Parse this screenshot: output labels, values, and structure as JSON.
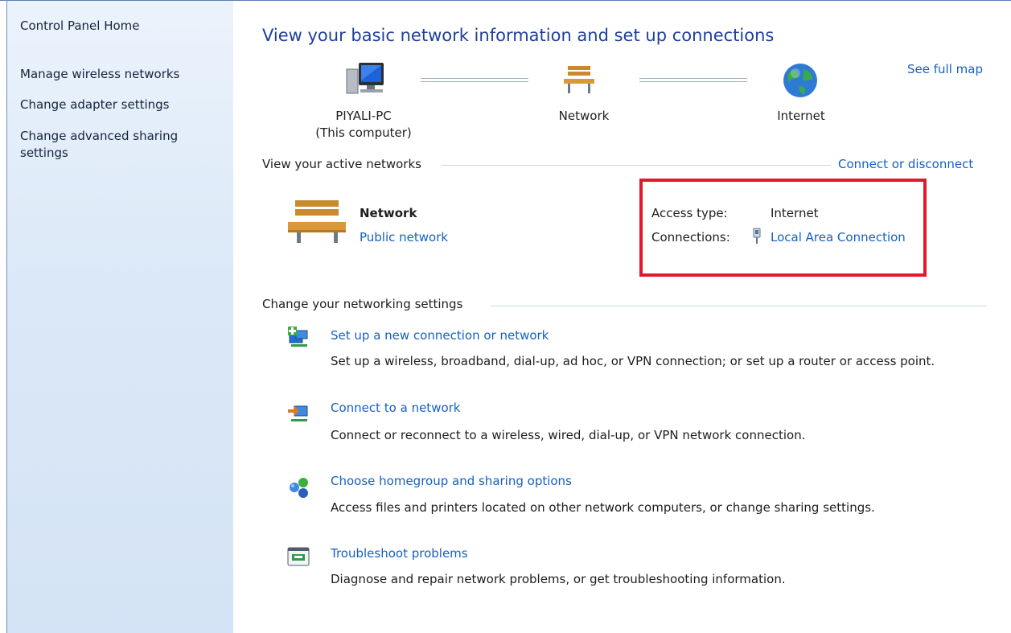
{
  "sidebar": {
    "home": "Control Panel Home",
    "items": [
      {
        "label": "Manage wireless networks"
      },
      {
        "label": "Change adapter settings"
      },
      {
        "label": "Change advanced sharing settings"
      }
    ]
  },
  "main": {
    "title": "View your basic network information and set up connections",
    "see_full_map": "See full map",
    "map": {
      "computer_name": "PIYALI-PC",
      "computer_sub": "(This computer)",
      "network": "Network",
      "internet": "Internet"
    },
    "active": {
      "heading": "View your active networks",
      "connect_link": "Connect or disconnect",
      "network_name": "Network",
      "network_type": "Public network",
      "access_label": "Access type:",
      "access_value": "Internet",
      "connections_label": "Connections:",
      "connections_value": "Local Area Connection"
    },
    "settings": {
      "heading": "Change your networking settings",
      "tasks": [
        {
          "title": "Set up a new connection or network",
          "desc": "Set up a wireless, broadband, dial-up, ad hoc, or VPN connection; or set up a router or access point."
        },
        {
          "title": "Connect to a network",
          "desc": "Connect or reconnect to a wireless, wired, dial-up, or VPN network connection."
        },
        {
          "title": "Choose homegroup and sharing options",
          "desc": "Access files and printers located on other network computers, or change sharing settings."
        },
        {
          "title": "Troubleshoot problems",
          "desc": "Diagnose and repair network problems, or get troubleshooting information."
        }
      ]
    }
  },
  "colors": {
    "link": "#1560c4",
    "title": "#1e3f9e",
    "highlight": "#e0192c",
    "sidebar": "#dbe8f7"
  },
  "icons": [
    "computer-icon",
    "bench-network-icon",
    "globe-internet-icon",
    "network-cable-icon",
    "new-connection-icon",
    "connect-network-icon",
    "homegroup-icon",
    "troubleshoot-icon"
  ]
}
